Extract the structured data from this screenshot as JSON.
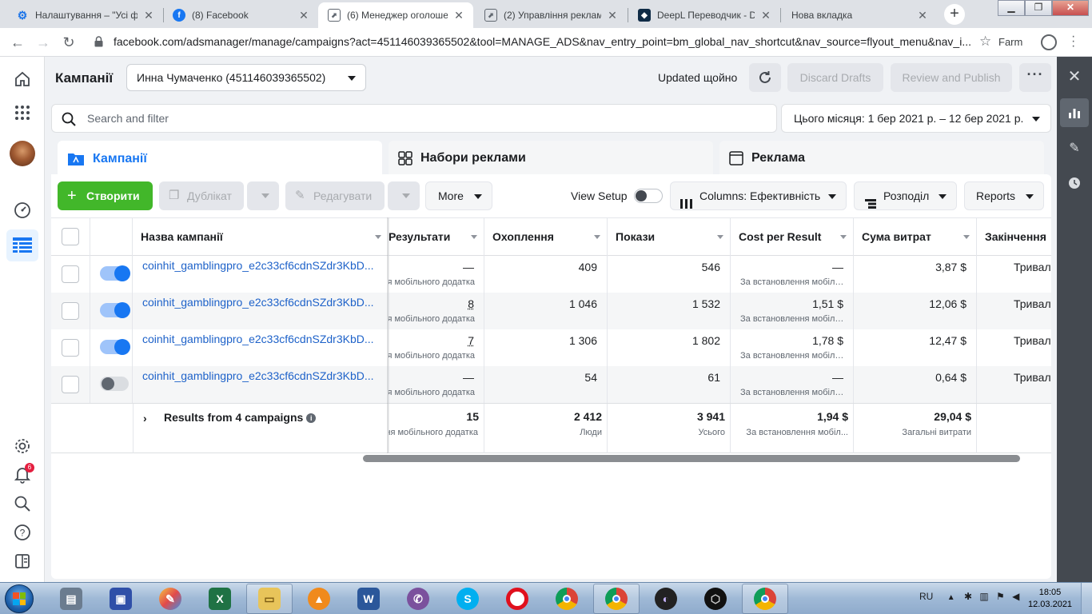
{
  "browser": {
    "tabs": [
      {
        "title": "Налаштування – \"Усі фа",
        "favicon": "gear-icon",
        "color": "#1a73e8"
      },
      {
        "title": "(8) Facebook",
        "favicon": "facebook-icon",
        "color": "#1877f2"
      },
      {
        "title": "(6) Менеджер оголоше",
        "favicon": "ads-manager-icon",
        "color": "#606770"
      },
      {
        "title": "(2) Управління реклам",
        "favicon": "ads-manager-icon",
        "color": "#606770"
      },
      {
        "title": "DeepL Переводчик - De",
        "favicon": "deepl-icon",
        "color": "#0f2b46"
      },
      {
        "title": "Нова вкладка",
        "favicon": "",
        "color": ""
      }
    ],
    "url": "facebook.com/adsmanager/manage/campaigns?act=451146039365502&tool=MANAGE_ADS&nav_entry_point=bm_global_nav_shortcut&nav_source=flyout_menu&nav_i...",
    "profile_name": "Farm"
  },
  "header": {
    "title": "Кампанії",
    "account": "Инна Чумаченко (451146039365502)",
    "updated": "Updated щойно",
    "discard": "Discard Drafts",
    "review": "Review and Publish"
  },
  "search": {
    "placeholder": "Search and filter"
  },
  "date_range": "Цього місяця: 1 бер 2021 р. – 12 бер 2021 р.",
  "level_tabs": {
    "campaigns": "Кампанії",
    "adsets": "Набори реклами",
    "ads": "Реклама"
  },
  "toolbar": {
    "create": "Створити",
    "duplicate": "Дублікат",
    "edit": "Редагувати",
    "more": "More",
    "view_setup": "View Setup",
    "columns": "Columns: Ефективність",
    "breakdown": "Розподіл",
    "reports": "Reports"
  },
  "table": {
    "headers": {
      "name": "Назва кампанії",
      "results": "Результати",
      "reach": "Охоплення",
      "impressions": "Покази",
      "cpr": "Cost per Result",
      "spent": "Сума витрат",
      "ends": "Закінчення"
    },
    "rows": [
      {
        "on": true,
        "name": "coinhit_gamblingpro_e2c33cf6cdnSZdr3KbD...",
        "results": "—",
        "results_sub": "За встановлення мобільного додатка",
        "reach": "409",
        "impressions": "546",
        "cpr": "—",
        "cpr_sub": "За встановлення мобільного додатка",
        "spent": "3,87 $",
        "ends": "Тривал"
      },
      {
        "on": true,
        "name": "coinhit_gamblingpro_e2c33cf6cdnSZdr3KbD...",
        "results": "8",
        "results_sub": "За встановлення мобільного додатка",
        "reach": "1 046",
        "impressions": "1 532",
        "cpr": "1,51 $",
        "cpr_sub": "За встановлення мобільного додатка",
        "spent": "12,06 $",
        "ends": "Тривал"
      },
      {
        "on": true,
        "name": "coinhit_gamblingpro_e2c33cf6cdnSZdr3KbD...",
        "results": "7",
        "results_sub": "За встановлення мобільного додатка",
        "reach": "1 306",
        "impressions": "1 802",
        "cpr": "1,78 $",
        "cpr_sub": "За встановлення мобільного додатка",
        "spent": "12,47 $",
        "ends": "Тривал"
      },
      {
        "on": false,
        "name": "coinhit_gamblingpro_e2c33cf6cdnSZdr3KbD...",
        "results": "—",
        "results_sub": "За встановлення мобільного додатка",
        "reach": "54",
        "impressions": "61",
        "cpr": "—",
        "cpr_sub": "За встановлення мобільного додатка",
        "spent": "0,64 $",
        "ends": "Тривал"
      }
    ],
    "summary": {
      "label": "Results from 4 campaigns",
      "results": "15",
      "results_sub": "За встановлення мобільного додатка",
      "reach": "2 412",
      "reach_sub": "Люди",
      "impressions": "3 941",
      "impressions_sub": "Усього",
      "cpr": "1,94 $",
      "cpr_sub": "За встановлення мобіл...",
      "spent": "29,04 $",
      "spent_sub": "Загальні витрати"
    }
  },
  "leftnav": {
    "notifications_badge": "6"
  },
  "taskbar": {
    "apps": [
      "scanner-icon",
      "floppy-icon",
      "paint-icon",
      "excel-icon",
      "explorer-icon",
      "avast-icon",
      "word-icon",
      "viber-icon",
      "skype-icon",
      "opera-icon",
      "chrome-icon",
      "chrome-profile-icon",
      "vpn-icon",
      "app-icon",
      "chrome-active-icon"
    ],
    "lang": "RU",
    "time": "18:05",
    "date": "12.03.2021"
  }
}
